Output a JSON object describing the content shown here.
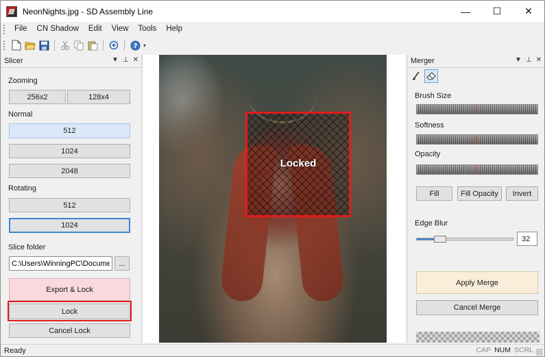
{
  "window": {
    "title": "NeonNights.jpg - SD Assembly Line",
    "controls": {
      "minimize": "—",
      "maximize": "☐",
      "close": "✕"
    }
  },
  "menu": [
    "File",
    "CN Shadow",
    "Edit",
    "View",
    "Tools",
    "Help"
  ],
  "toolbar": {
    "icons": [
      "new-file-icon",
      "open-folder-icon",
      "save-icon",
      "cut-icon",
      "copy-icon",
      "paste-icon",
      "add-circle-icon",
      "help-icon"
    ]
  },
  "slicer": {
    "title": "Slicer",
    "zooming_label": "Zooming",
    "zoom_buttons": [
      "256x2",
      "128x4"
    ],
    "normal_label": "Normal",
    "normal_buttons": [
      "512",
      "1024",
      "2048"
    ],
    "rotating_label": "Rotating",
    "rotating_buttons": [
      "512",
      "1024"
    ],
    "folder_label": "Slice folder",
    "folder_value": "C:\\Users\\WinningPC\\Documen",
    "browse_label": "...",
    "export_lock_label": "Export & Lock",
    "lock_label": "Lock",
    "cancel_lock_label": "Cancel Lock"
  },
  "canvas": {
    "overlay_text": "Locked"
  },
  "merger": {
    "title": "Merger",
    "tools": [
      "brush-icon",
      "eraser-icon"
    ],
    "brush_size_label": "Brush Size",
    "softness_label": "Softness",
    "opacity_label": "Opacity",
    "brush_size_level": 0.49,
    "softness_level": 0.49,
    "opacity_level": 0.49,
    "fill_label": "Fill",
    "fill_opacity_label": "Fill Opacity",
    "invert_label": "Invert",
    "edge_blur_label": "Edge Blur",
    "edge_blur_value": "32",
    "edge_blur_level": 0.25,
    "apply_merge_label": "Apply Merge",
    "cancel_merge_label": "Cancel Merge"
  },
  "status": {
    "text": "Ready",
    "indicators": [
      {
        "label": "CAP",
        "on": false
      },
      {
        "label": "NUM",
        "on": true
      },
      {
        "label": "SCRL",
        "on": false
      }
    ]
  },
  "colors": {
    "highlight_red": "#e21b1b",
    "focus_blue": "#3c84d6",
    "export_pink": "#f9d9dd",
    "apply_cream": "#faeedb"
  }
}
